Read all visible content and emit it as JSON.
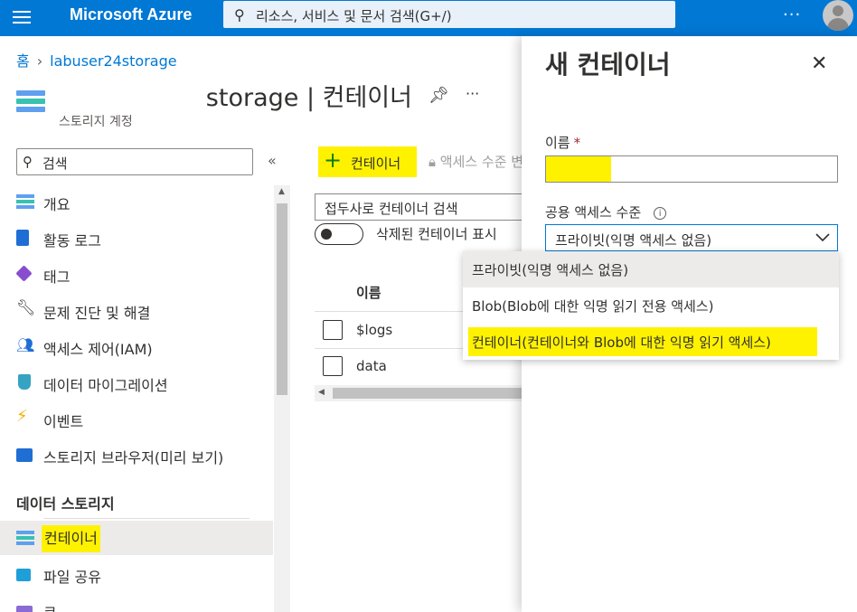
{
  "topbar": {
    "brand": "Microsoft Azure",
    "search_placeholder": "리소스, 서비스 및 문서 검색(G+/)",
    "more": "···"
  },
  "breadcrumb": {
    "home": "홈",
    "resource": "labuser24storage"
  },
  "resource": {
    "title": "labuser24storage | 컨테이너",
    "visible_title": "storage | 컨테이너",
    "subtitle": "스토리지 계정",
    "more": "···"
  },
  "nav": {
    "search_placeholder": "검색",
    "collapse": "«",
    "items": [
      {
        "label": "개요",
        "icon": "storage-icon"
      },
      {
        "label": "활동 로그",
        "icon": "activity-log-icon"
      },
      {
        "label": "태그",
        "icon": "tag-icon"
      },
      {
        "label": "문제 진단 및 해결",
        "icon": "wrench-icon"
      },
      {
        "label": "액세스 제어(IAM)",
        "icon": "people-icon"
      },
      {
        "label": "데이터 마이그레이션",
        "icon": "migration-icon"
      },
      {
        "label": "이벤트",
        "icon": "lightning-icon"
      },
      {
        "label": "스토리지 브라우저(미리 보기)",
        "icon": "browser-icon"
      }
    ],
    "section_title": "데이터 스토리지",
    "data_items": [
      {
        "label": "컨테이너",
        "icon": "container-icon",
        "active": true
      },
      {
        "label": "파일 공유",
        "icon": "file-share-icon"
      },
      {
        "label": "큐",
        "icon": "queue-icon"
      }
    ]
  },
  "commands": {
    "add_container": "컨테이너",
    "access_level": "액세스 수준 변경"
  },
  "filter": {
    "placeholder": "접두사로 컨테이너 검색"
  },
  "toggle": {
    "label": "삭제된 컨테이너 표시"
  },
  "table": {
    "column": "이름",
    "rows": [
      "$logs",
      "data"
    ]
  },
  "panel": {
    "title": "새 컨테이너",
    "close": "✕",
    "name_label": "이름",
    "required_mark": "*",
    "name_value": "",
    "access_label": "공용 액세스 수준",
    "info": "i",
    "selected": "프라이빗(익명 액세스 없음)",
    "options": [
      "프라이빗(익명 액세스 없음)",
      "Blob(Blob에 대한 익명 읽기 전용 액세스)",
      "컨테이너(컨테이너와 Blob에 대한 익명 읽기 액세스)"
    ]
  },
  "colors": {
    "brand_blue": "#0078d4",
    "highlight": "#fff200",
    "add_green": "#107c10"
  }
}
